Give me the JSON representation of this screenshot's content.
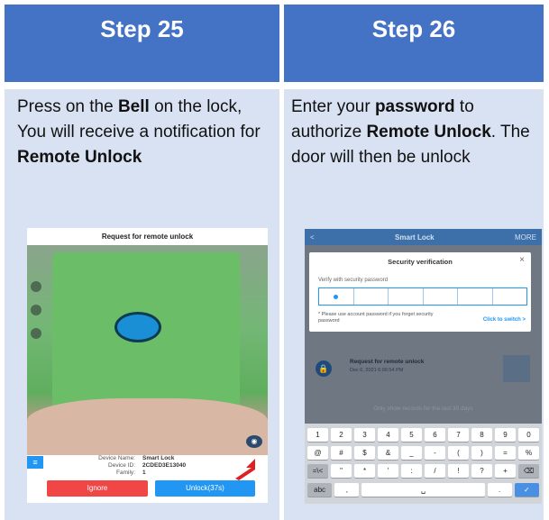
{
  "left": {
    "header": "Step 25",
    "desc_parts": [
      "Press on the ",
      "Bell",
      " on the lock, You will receive a notification for ",
      "Remote Unlock"
    ],
    "phone": {
      "title": "Request for remote unlock",
      "device_name_label": "Device Name:",
      "device_name": "Smart Lock",
      "device_id_label": "Device ID:",
      "device_id": "2CDED3E13040",
      "family_label": "Family:",
      "family": "1",
      "ignore_button": "Ignore",
      "unlock_button": "Unlock(37s)"
    }
  },
  "right": {
    "header": "Step 26",
    "desc_parts": [
      "Enter your ",
      "password",
      " to authorize ",
      "Remote Unlock",
      ". The door will then be unlock"
    ],
    "phone": {
      "back": "<",
      "title": "Smart Lock",
      "more": "MORE",
      "dialog_title": "Security verification",
      "close": "×",
      "verify_label": "Verify with security password",
      "note": "* Please use account password if you forget security password",
      "switch_link": "Click to switch >",
      "record_title": "Request for remote unlock",
      "record_time": "Dec 6, 2021 6:06:54 PM",
      "only_show": "Only show records for the last 30 days",
      "keyboard": {
        "row1": [
          "1",
          "2",
          "3",
          "4",
          "5",
          "6",
          "7",
          "8",
          "9",
          "0"
        ],
        "row2": [
          "@",
          "#",
          "$",
          "&",
          "_",
          "-",
          "(",
          ")",
          "=",
          "%"
        ],
        "row3": [
          "=\\<",
          "\"",
          "*",
          "'",
          ":",
          "/",
          "!",
          "?",
          "+",
          "⌫"
        ],
        "abc": "abc",
        "comma": ",",
        "space": "␣",
        "period": "."
      }
    }
  },
  "colors": {
    "header_bg": "#4472c4",
    "body_bg": "#d9e2f3",
    "accent_blue": "#2196f3",
    "ignore_red": "#f04646"
  }
}
